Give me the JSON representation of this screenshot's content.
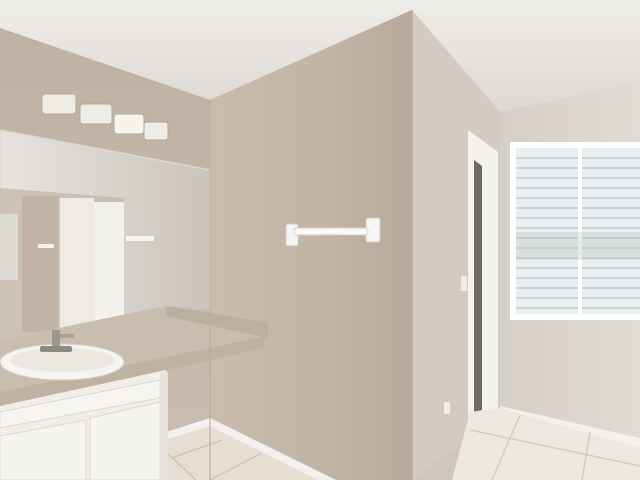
{
  "scene": {
    "type": "photo",
    "subject": "bathroom-vanity-with-mirror-window-and-tile-floor"
  },
  "colors": {
    "ceiling": "#e9e6e2",
    "wall_left": "#c7bcb0",
    "wall_center": "#c4b6a8",
    "wall_right": "#d8d2ca",
    "floor": "#e7e1d8",
    "cabinet": "#f2f0ec",
    "counter": "#c9beb1",
    "mirror": "#d6d2cc",
    "window": "#f4f6f7",
    "trim": "#ffffff"
  }
}
